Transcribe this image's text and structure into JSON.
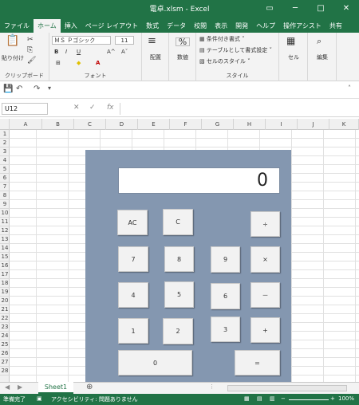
{
  "title": "電卓.xlsm  -  Excel",
  "window_buttons": [
    "▭",
    "─",
    "□",
    "✕"
  ],
  "tabs": [
    "ファイル",
    "ホーム",
    "挿入",
    "ページ レイアウト",
    "数式",
    "データ",
    "校閲",
    "表示",
    "開発",
    "ヘルプ",
    "操作アシスト",
    "共有"
  ],
  "ribbon": {
    "paste": "貼り付け",
    "clipboard": "クリップボード",
    "font_name": "ＭＳ Ｐゴシック",
    "font_size": "11",
    "font_group": "フォント",
    "align": "配置",
    "number": "数値",
    "cond_format": "条件付き書式",
    "table_format": "テーブルとして書式設定",
    "cell_style": "セルのスタイル",
    "style_group": "スタイル",
    "cells": "セル",
    "edit": "編集",
    "bold": "B",
    "italic": "I",
    "underline": "U",
    "percent": "%"
  },
  "formula_bar": {
    "name_box": "U12",
    "fx": "fx",
    "value": ""
  },
  "columns": [
    "A",
    "B",
    "C",
    "D",
    "E",
    "F",
    "G",
    "H",
    "I",
    "J",
    "K"
  ],
  "rows": [
    "1",
    "2",
    "3",
    "4",
    "5",
    "6",
    "7",
    "8",
    "9",
    "10",
    "11",
    "12",
    "13",
    "14",
    "15",
    "16",
    "17",
    "18",
    "19",
    "20",
    "21",
    "22",
    "23",
    "24",
    "25",
    "26",
    "27",
    "28"
  ],
  "calculator": {
    "display": "0",
    "keys": {
      "ac": "AC",
      "c": "C",
      "div": "÷",
      "k7": "7",
      "k8": "8",
      "k9": "9",
      "mul": "×",
      "k4": "4",
      "k5": "5",
      "k6": "6",
      "sub": "－",
      "k1": "1",
      "k2": "2",
      "k3": "3",
      "add": "+",
      "k0": "0",
      "eq": "="
    }
  },
  "sheet_tab": "Sheet1",
  "status": {
    "ready": "準備完了",
    "accessibility": "アクセシビリティ: 問題ありません",
    "zoom": "100%"
  }
}
